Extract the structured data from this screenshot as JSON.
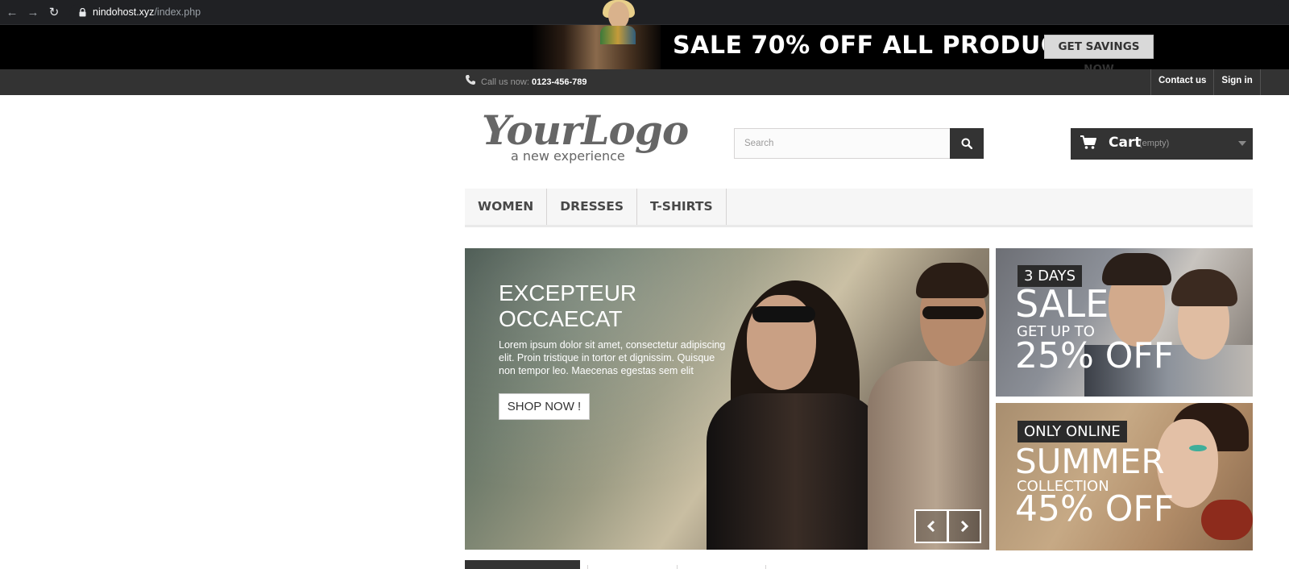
{
  "browser": {
    "url_host": "nindohost.xyz",
    "url_path": "/index.php"
  },
  "promo": {
    "headline": "SALE 70% OFF ALL PRODUCTS",
    "cta_label": "GET SAVINGS NOW"
  },
  "topnav": {
    "call_label": "Call us now:",
    "phone": "0123-456-789",
    "links": [
      "Contact us",
      "Sign in"
    ]
  },
  "header": {
    "logo_main": "YourLogo",
    "logo_sub": "a new experience",
    "search_placeholder": "Search",
    "cart_label": "Cart",
    "cart_status": "(empty)"
  },
  "menu": {
    "items": [
      "WOMEN",
      "DRESSES",
      "T-SHIRTS"
    ]
  },
  "slider": {
    "title": "EXCEPTEUR OCCAECAT",
    "text": "Lorem ipsum dolor sit amet, consectetur adipiscing elit. Proin tristique in tortor et dignissim. Quisque non tempor leo. Maecenas egestas sem elit",
    "button": "SHOP NOW !"
  },
  "banners": [
    {
      "tag": "3 DAYS",
      "line1": "SALE",
      "line2": "GET UP TO",
      "line3": "25% OFF"
    },
    {
      "tag": "ONLY ONLINE",
      "line1": "SUMMER",
      "line2": "COLLECTION",
      "line3": "45% OFF"
    }
  ],
  "colors": {
    "chrome": "#202124",
    "dark": "#333333",
    "promo_bg": "#000000",
    "menu_bg": "#f6f6f6"
  },
  "icons": {
    "back": "arrow-left-icon",
    "forward": "arrow-right-icon",
    "reload": "reload-icon",
    "lock": "lock-icon",
    "phone": "phone-icon",
    "search": "search-icon",
    "cart": "cart-icon",
    "prev": "chevron-left-icon",
    "next": "chevron-right-icon"
  }
}
